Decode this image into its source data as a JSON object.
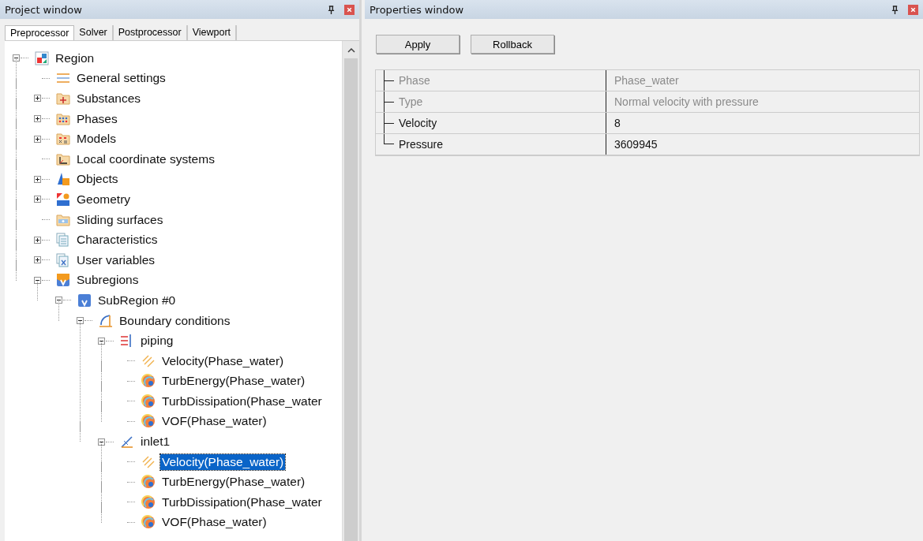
{
  "project_window": {
    "title": "Project window",
    "tabs": [
      {
        "label": "Preprocessor",
        "selected": true
      },
      {
        "label": "Solver",
        "selected": false
      },
      {
        "label": "Postprocessor",
        "selected": false
      },
      {
        "label": "Viewport",
        "selected": false
      }
    ],
    "tree": [
      {
        "label": "Region",
        "kind": "region",
        "expanded": true,
        "selected": false,
        "children": [
          {
            "label": "General settings",
            "kind": "settings",
            "selected": false
          },
          {
            "label": "Substances",
            "kind": "substances",
            "expanded": false,
            "selected": false
          },
          {
            "label": "Phases",
            "kind": "phases",
            "expanded": false,
            "selected": false
          },
          {
            "label": "Models",
            "kind": "models",
            "expanded": false,
            "selected": false
          },
          {
            "label": "Local coordinate systems",
            "kind": "coordinates",
            "selected": false
          },
          {
            "label": "Objects",
            "kind": "objects",
            "expanded": false,
            "selected": false
          },
          {
            "label": "Geometry",
            "kind": "geometry",
            "expanded": false,
            "selected": false
          },
          {
            "label": "Sliding surfaces",
            "kind": "sliding",
            "selected": false
          },
          {
            "label": "Characteristics",
            "kind": "characteristics",
            "expanded": false,
            "selected": false
          },
          {
            "label": "User variables",
            "kind": "variables",
            "expanded": false,
            "selected": false
          },
          {
            "label": "Subregions",
            "kind": "subregions",
            "expanded": true,
            "selected": false,
            "children": [
              {
                "label": "SubRegion #0",
                "kind": "subregion",
                "expanded": true,
                "selected": false,
                "children": [
                  {
                    "label": "Boundary conditions",
                    "kind": "boundary",
                    "expanded": true,
                    "selected": false,
                    "children": [
                      {
                        "label": "piping",
                        "kind": "piping",
                        "expanded": true,
                        "selected": false,
                        "children": [
                          {
                            "label": "Velocity(Phase_water)",
                            "kind": "velocity",
                            "selected": false
                          },
                          {
                            "label": "TurbEnergy(Phase_water)",
                            "kind": "field",
                            "selected": false
                          },
                          {
                            "label": "TurbDissipation(Phase_water",
                            "kind": "field",
                            "selected": false
                          },
                          {
                            "label": "VOF(Phase_water)",
                            "kind": "field",
                            "selected": false
                          }
                        ]
                      },
                      {
                        "label": "inlet1",
                        "kind": "inlet",
                        "expanded": true,
                        "selected": false,
                        "children": [
                          {
                            "label": "Velocity(Phase_water)",
                            "kind": "velocity",
                            "selected": true
                          },
                          {
                            "label": "TurbEnergy(Phase_water)",
                            "kind": "field",
                            "selected": false
                          },
                          {
                            "label": "TurbDissipation(Phase_water",
                            "kind": "field",
                            "selected": false
                          },
                          {
                            "label": "VOF(Phase_water)",
                            "kind": "field",
                            "selected": false
                          }
                        ]
                      }
                    ]
                  }
                ]
              }
            ]
          }
        ]
      }
    ]
  },
  "properties_window": {
    "title": "Properties window",
    "buttons": [
      "Apply",
      "Rollback"
    ],
    "properties": [
      {
        "name": "Phase",
        "value": "Phase_water",
        "disabled": true
      },
      {
        "name": "Type",
        "value": "Normal velocity with pressure",
        "disabled": true
      },
      {
        "name": "Velocity",
        "value": "8",
        "disabled": false
      },
      {
        "name": "Pressure",
        "value": "3609945",
        "disabled": false
      }
    ]
  }
}
